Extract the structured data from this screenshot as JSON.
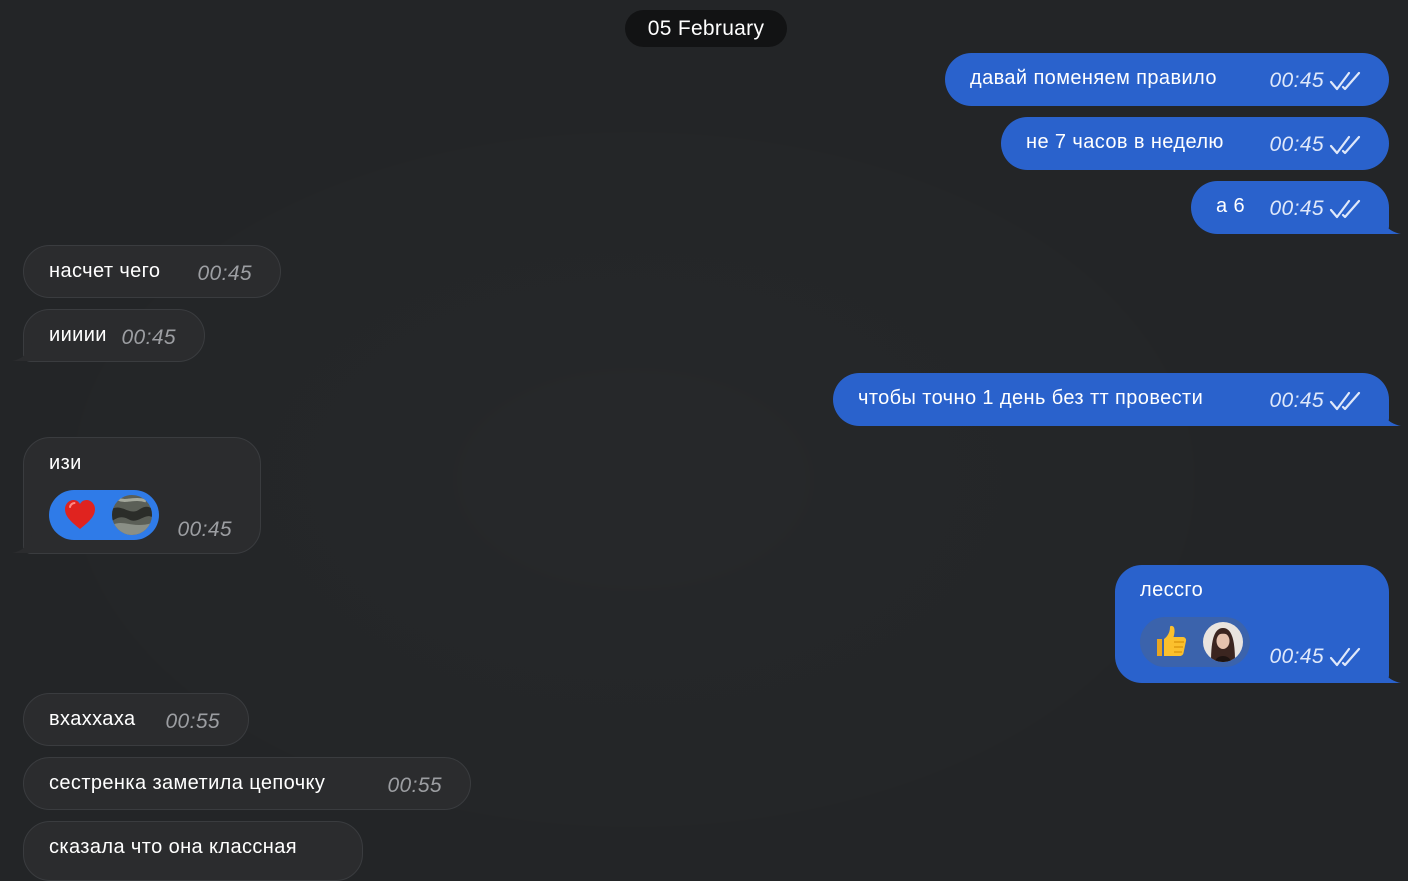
{
  "date_separator": "05 February",
  "messages": [
    {
      "dir": "out",
      "text": "давай поменяем правило",
      "time": "00:45"
    },
    {
      "dir": "out",
      "text": "не 7 часов в неделю",
      "time": "00:45"
    },
    {
      "dir": "out",
      "text": "а 6",
      "time": "00:45"
    },
    {
      "dir": "in",
      "text": "насчет чего",
      "time": "00:45"
    },
    {
      "dir": "in",
      "text": "иииии",
      "time": "00:45"
    },
    {
      "dir": "out",
      "text": "чтобы точно 1 день без тт провести",
      "time": "00:45"
    },
    {
      "dir": "in",
      "text": "изи",
      "time": "00:45",
      "reaction": "red-heart-icon"
    },
    {
      "dir": "out",
      "text": "лессго",
      "time": "00:45",
      "reaction": "thumbs-up-icon"
    },
    {
      "dir": "in",
      "text": "вхаххаха",
      "time": "00:55"
    },
    {
      "dir": "in",
      "text": "сестренка заметила цепочку",
      "time": "00:55"
    },
    {
      "dir": "in",
      "text": "сказала что она классная",
      "time": ""
    }
  ],
  "colors": {
    "background": "#232527",
    "outgoing_bubble": "#2a62cc",
    "incoming_bubble": "#2b2c2e",
    "date_pill": "#121314"
  }
}
